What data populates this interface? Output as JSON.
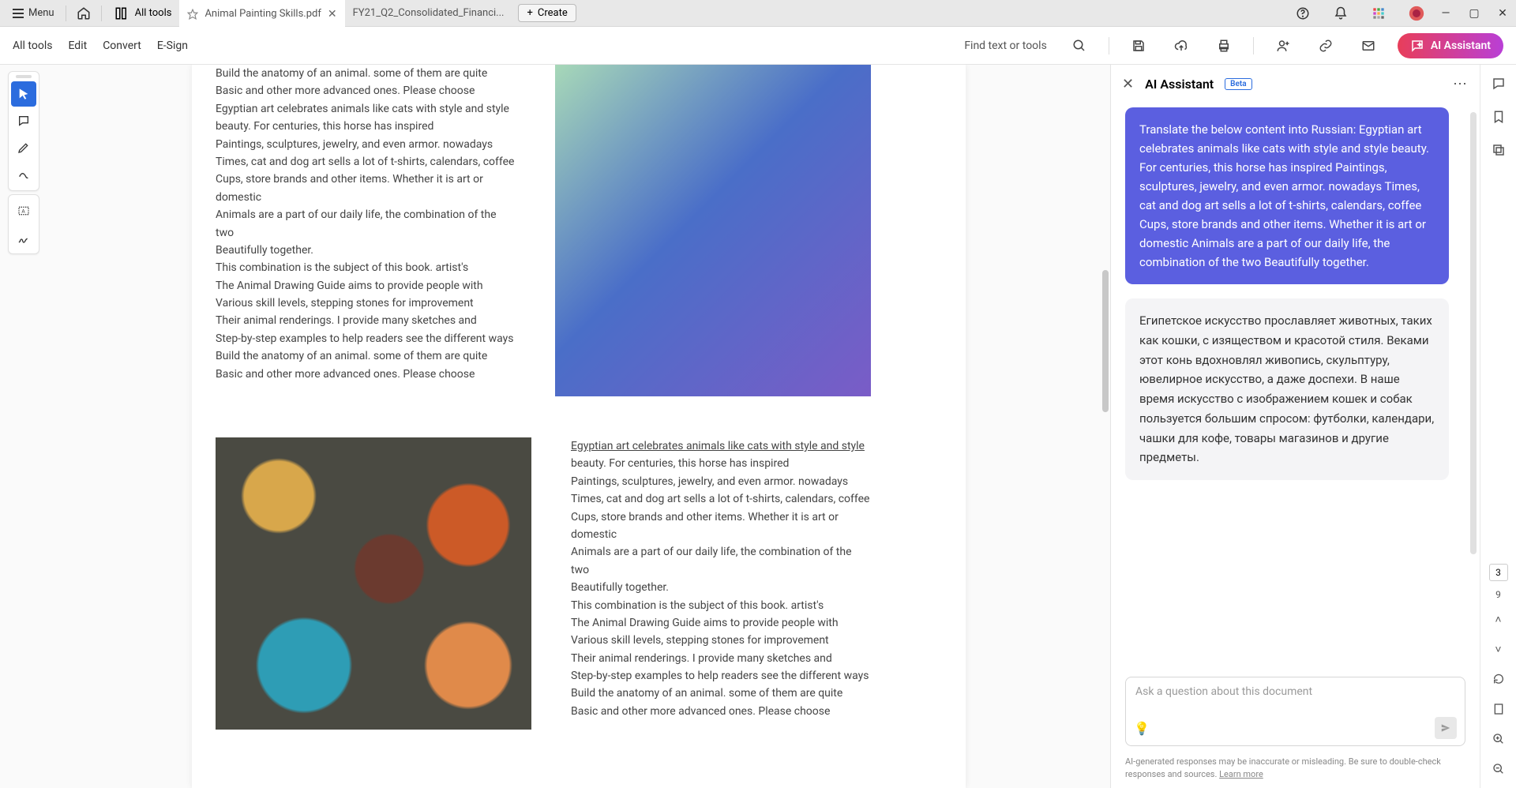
{
  "titlebar": {
    "menu_label": "Menu",
    "alltools_label": "All tools",
    "tabs": [
      {
        "title": "Animal Painting Skills.pdf",
        "active": true
      },
      {
        "title": "FY21_Q2_Consolidated_Financi...",
        "active": false
      }
    ],
    "create_label": "Create"
  },
  "toolbar": {
    "items": [
      "All tools",
      "Edit",
      "Convert",
      "E-Sign"
    ],
    "find_label": "Find text or tools",
    "ai_label": "AI Assistant"
  },
  "document": {
    "block1": [
      "Build the anatomy of an animal. some of them are quite",
      "Basic and other more advanced ones. Please choose",
      "Egyptian art celebrates animals like cats with style and style",
      "beauty. For centuries, this horse has inspired",
      "Paintings, sculptures, jewelry, and even armor. nowadays",
      "Times, cat and dog art sells a lot of t-shirts, calendars, coffee",
      "Cups, store brands and other items. Whether it is art or domestic",
      "Animals are a part of our daily life, the combination of the two",
      "Beautifully together.",
      "This combination is the subject of this book. artist's",
      "The Animal Drawing Guide aims to provide people with",
      "Various skill levels, stepping stones for improvement",
      "Their animal renderings. I provide many sketches and",
      "Step-by-step examples to help readers see the different ways",
      "Build the anatomy of an animal. some of them are quite",
      "Basic and other more advanced ones. Please choose"
    ],
    "block2_underlined": "Egyptian art celebrates animals like cats with style and style",
    "block2": [
      "beauty. For centuries, this horse has inspired",
      "Paintings, sculptures, jewelry, and even armor. nowadays",
      "Times, cat and dog art sells a lot of t-shirts, calendars, coffee",
      "Cups, store brands and other items. Whether it is art or domestic",
      "Animals are a part of our daily life, the combination of the two",
      "Beautifully together.",
      "This combination is the subject of this book. artist's",
      "The Animal Drawing Guide aims to provide people with",
      "Various skill levels, stepping stones for improvement",
      "Their animal renderings. I provide many sketches and",
      "Step-by-step examples to help readers see the different ways",
      "Build the anatomy of an animal. some of them are quite",
      "Basic and other more advanced ones. Please choose"
    ]
  },
  "ai_panel": {
    "title": "AI Assistant",
    "badge": "Beta",
    "user_message": "Translate the below content into Russian: Egyptian art celebrates animals like cats with style and style beauty. For centuries, this horse has inspired Paintings, sculptures, jewelry, and even armor. nowadays Times, cat and dog art sells a lot of t-shirts, calendars, coffee Cups, store brands and other items. Whether it is art or domestic Animals are a part of our daily life, the combination of the two Beautifully together.",
    "assistant_message": "Египетское искусство прославляет животных, таких как кошки, с изяществом и красотой стиля. Веками этот конь вдохновлял живопись, скульптуру, ювелирное искусство, а даже доспехи. В наше время искусство с изображением кошек и собак пользуется большим спросом: футболки, календари, чашки для кофе, товары магазинов и другие предметы.",
    "input_placeholder": "Ask a question about this document",
    "disclaimer": "AI-generated responses may be inaccurate or misleading. Be sure to double-check responses and sources.",
    "learn_more": "Learn more"
  },
  "right_rail": {
    "page_current": "3",
    "page_total": "9"
  }
}
